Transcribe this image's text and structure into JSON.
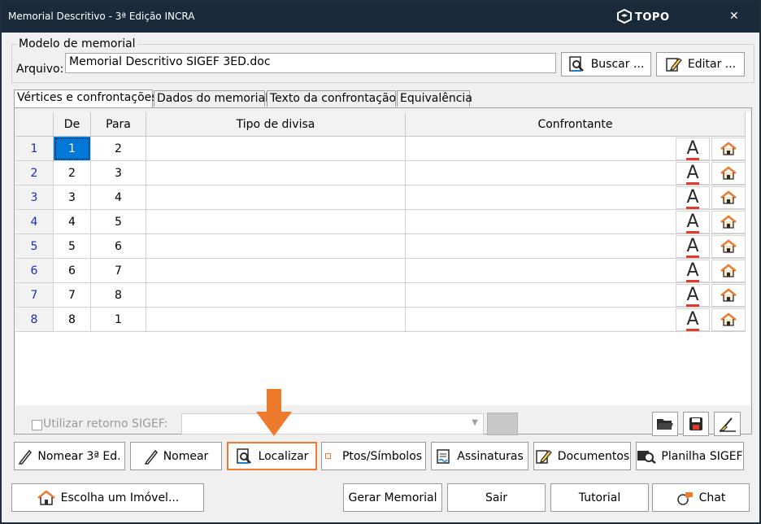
{
  "window": {
    "title": "Memorial Descritivo - 3ª Edição INCRA",
    "logo_text": "TOPO",
    "close_glyph": "✕"
  },
  "model": {
    "legend": "Modelo de memorial",
    "file_label": "Arquivo:",
    "file_value": "Memorial Descritivo SIGEF 3ED.doc",
    "search_button": "Buscar ...",
    "edit_button": "Editar ..."
  },
  "tabs": [
    {
      "label": "Vértices e confrontações"
    },
    {
      "label": "Dados do memorial"
    },
    {
      "label": "Texto da confrontação"
    },
    {
      "label": "Equivalência"
    }
  ],
  "grid": {
    "columns": [
      "De",
      "Para",
      "Tipo de divisa",
      "Confrontante"
    ],
    "font_icon_glyph": "A",
    "rows": [
      {
        "num": "1",
        "de": "1",
        "para": "2",
        "tipo": "",
        "confrontante": ""
      },
      {
        "num": "2",
        "de": "2",
        "para": "3",
        "tipo": "",
        "confrontante": ""
      },
      {
        "num": "3",
        "de": "3",
        "para": "4",
        "tipo": "",
        "confrontante": ""
      },
      {
        "num": "4",
        "de": "4",
        "para": "5",
        "tipo": "",
        "confrontante": ""
      },
      {
        "num": "5",
        "de": "5",
        "para": "6",
        "tipo": "",
        "confrontante": ""
      },
      {
        "num": "6",
        "de": "6",
        "para": "7",
        "tipo": "",
        "confrontante": ""
      },
      {
        "num": "7",
        "de": "7",
        "para": "8",
        "tipo": "",
        "confrontante": ""
      },
      {
        "num": "8",
        "de": "8",
        "para": "1",
        "tipo": "",
        "confrontante": ""
      }
    ]
  },
  "sigef": {
    "checkbox_label": "Utilizar retorno SIGEF:",
    "checked": false,
    "dropdown_value": ""
  },
  "toolbar": {
    "nomear3": "Nomear 3ª Ed.",
    "nomear": "Nomear",
    "localizar": "Localizar",
    "ptos": "Ptos/Símbolos",
    "assinaturas": "Assinaturas",
    "documentos": "Documentos",
    "planilha": "Planilha SIGEF"
  },
  "footer": {
    "escolha": "Escolha um Imóvel...",
    "gerar": "Gerar Memorial",
    "sair": "Sair",
    "tutorial": "Tutorial",
    "chat": "Chat"
  },
  "colors": {
    "titlebar": "#1b2a3a",
    "highlight": "#ee7a2d",
    "selection": "#0078d7"
  }
}
